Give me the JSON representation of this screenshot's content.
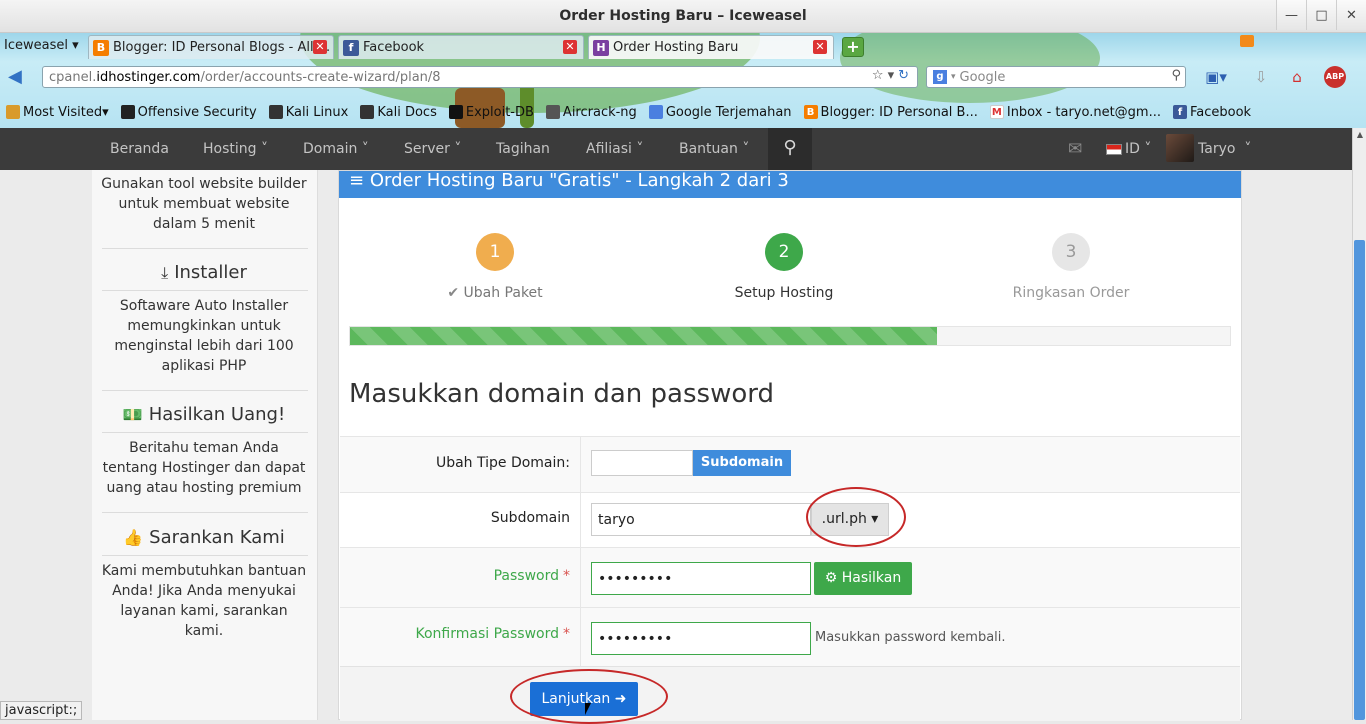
{
  "window": {
    "title": "Order Hosting Baru – Iceweasel"
  },
  "browser": {
    "app_menu": "Iceweasel",
    "tabs": [
      {
        "label": "Blogger: ID Personal Blogs - All ...",
        "icon": "blogger-icon",
        "active": false
      },
      {
        "label": "Facebook",
        "icon": "facebook-icon",
        "active": false
      },
      {
        "label": "Order Hosting Baru",
        "icon": "hostinger-icon",
        "active": true
      }
    ],
    "url": {
      "prefix": "cpanel.",
      "host": "idhostinger.com",
      "path": "/order/accounts-create-wizard/plan/8"
    },
    "search": {
      "placeholder": "Google"
    },
    "bookmarks": [
      {
        "label": "Most Visited",
        "icon": "folder-icon"
      },
      {
        "label": "Offensive Security",
        "icon": "offsec-icon"
      },
      {
        "label": "Kali Linux",
        "icon": "kali-icon"
      },
      {
        "label": "Kali Docs",
        "icon": "kali-icon"
      },
      {
        "label": "Exploit-DB",
        "icon": "exploitdb-icon"
      },
      {
        "label": "Aircrack-ng",
        "icon": "aircrack-icon"
      },
      {
        "label": "Google Terjemahan",
        "icon": "translate-icon"
      },
      {
        "label": "Blogger: ID Personal B...",
        "icon": "blogger-icon"
      },
      {
        "label": "Inbox - taryo.net@gm...",
        "icon": "gmail-icon"
      },
      {
        "label": "Facebook",
        "icon": "facebook-icon"
      }
    ],
    "status_text": "javascript:;"
  },
  "site_nav": {
    "items": [
      "Beranda",
      "Hosting",
      "Domain",
      "Server",
      "Tagihan",
      "Afiliasi",
      "Bantuan"
    ],
    "language": "ID",
    "user": "Taryo"
  },
  "sidebar": {
    "intro": "Gunakan tool website builder untuk membuat website dalam 5 menit",
    "sections": [
      {
        "title": "Installer",
        "icon": "download-icon",
        "text": "Softaware Auto Installer memungkinkan untuk menginstal lebih dari 100 aplikasi PHP"
      },
      {
        "title": "Hasilkan Uang!",
        "icon": "money-icon",
        "text": "Beritahu teman Anda tentang Hostinger dan dapat uang atau hosting premium"
      },
      {
        "title": "Sarankan Kami",
        "icon": "thumbs-up-icon",
        "text": "Kami membutuhkan bantuan Anda! Jika Anda menyukai layanan kami, sarankan kami."
      }
    ]
  },
  "wizard": {
    "header": "Order Hosting Baru \"Gratis\" - Langkah 2 dari 3",
    "steps": [
      {
        "num": "1",
        "label": "Ubah Paket",
        "state": "done",
        "color": "#f0ad4e"
      },
      {
        "num": "2",
        "label": "Setup Hosting",
        "state": "current",
        "color": "#3ea84a"
      },
      {
        "num": "3",
        "label": "Ringkasan Order",
        "state": "pending",
        "color": "#e6e6e6"
      }
    ],
    "progress_fraction": 0.667,
    "heading": "Masukkan domain dan password",
    "form": {
      "domain_type_label": "Ubah Tipe Domain:",
      "domain_type_button": "Subdomain",
      "subdomain_label": "Subdomain",
      "subdomain_value": "taryo",
      "subdomain_suffix": ".url.ph",
      "password_label": "Password",
      "password_value": "•••••••••",
      "generate_button": "Hasilkan",
      "confirm_label": "Konfirmasi Password",
      "confirm_value": "•••••••••",
      "confirm_hint": "Masukkan password kembali.",
      "submit_button": "Lanjutkan"
    }
  },
  "colors": {
    "accent": "#3f8cdc",
    "success": "#3ea84a",
    "annotation": "#c62828",
    "nav_bg": "#3b3b3b"
  }
}
